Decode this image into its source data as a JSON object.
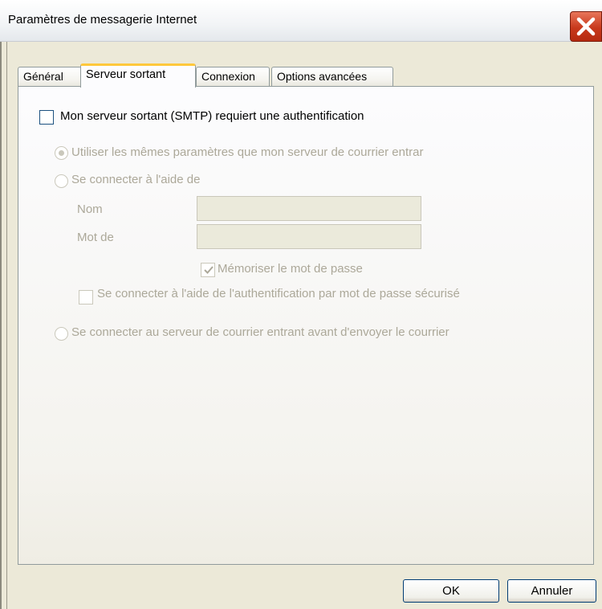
{
  "window": {
    "title": "Paramètres de messagerie Internet"
  },
  "tabs": [
    {
      "label": "Général"
    },
    {
      "label": "Serveur sortant"
    },
    {
      "label": "Connexion"
    },
    {
      "label": "Options avancées"
    }
  ],
  "active_tab": "Serveur sortant",
  "smtp_auth": {
    "label": "Mon serveur sortant (SMTP) requiert une authentification",
    "checked": false
  },
  "options": {
    "same_settings": {
      "label": "Utiliser les mêmes paramètres que mon serveur de courrier entrar",
      "selected": true
    },
    "connect_with": {
      "label": "Se connecter à l'aide de",
      "selected": false
    },
    "name_label": "Nom",
    "password_label": "Mot de",
    "remember_password": {
      "label": "Mémoriser le mot de passe",
      "checked": true
    },
    "spa": {
      "label": "Se connecter à l'aide de l'authentification par mot de passe sécurisé",
      "checked": false
    },
    "connect_incoming_first": {
      "label": "Se connecter au serveur de courrier entrant avant d'envoyer le courrier",
      "selected": false
    }
  },
  "buttons": {
    "ok": "OK",
    "cancel": "Annuler"
  },
  "icons": {
    "close": "close-icon",
    "check": "checkmark-icon"
  },
  "colors": {
    "close_button": "#c8391c",
    "active_tab_accent": "#ffc83c",
    "disabled_text": "#aca899"
  }
}
